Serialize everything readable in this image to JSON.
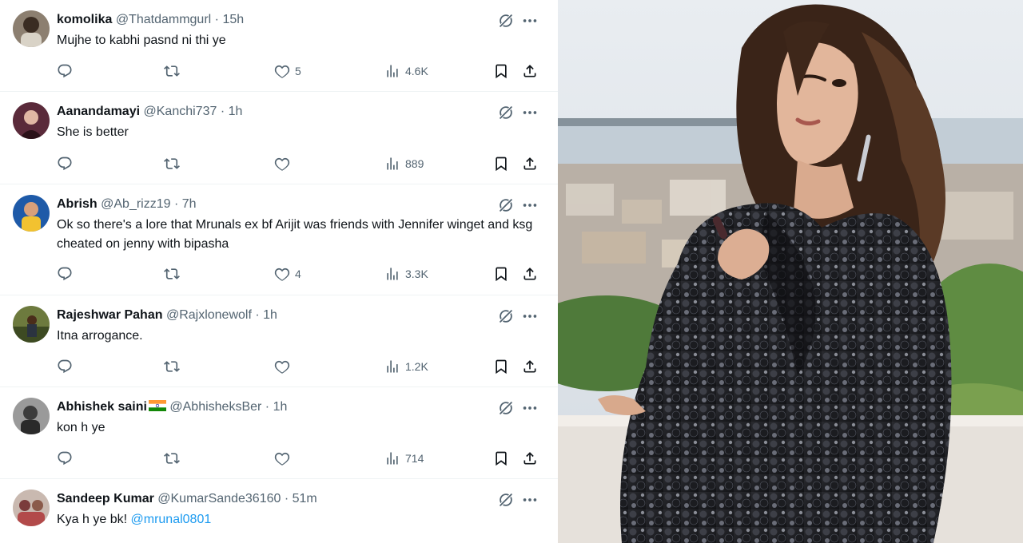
{
  "tweets": [
    {
      "name": "komolika",
      "handle": "@Thatdammgurl",
      "dot": "·",
      "time": "15h",
      "text": "Mujhe to kabhi pasnd ni thi ye",
      "likes": "5",
      "views": "4.6K"
    },
    {
      "name": "Aanandamayi",
      "handle": "@Kanchi737",
      "dot": "·",
      "time": "1h",
      "text": "She is better",
      "likes": "",
      "views": "889"
    },
    {
      "name": "Abrish",
      "handle": "@Ab_rizz19",
      "dot": "·",
      "time": "7h",
      "text": "Ok so there's a lore that Mrunals ex bf Arijit was friends with Jennifer winget and ksg cheated on jenny with bipasha",
      "likes": "4",
      "views": "3.3K"
    },
    {
      "name": "Rajeshwar Pahan",
      "handle": "@Rajxlonewolf",
      "dot": "·",
      "time": "1h",
      "text": "Itna arrogance.",
      "likes": "",
      "views": "1.2K"
    },
    {
      "name": "Abhishek saini",
      "handle": "@AbhisheksBer",
      "dot": "·",
      "time": "1h",
      "text": "kon h ye",
      "likes": "",
      "views": "714"
    },
    {
      "name": "Sandeep Kumar",
      "handle": "@KumarSande36160",
      "dot": "·",
      "time": "51m",
      "text": "Kya h ye bk!",
      "mention": "@mrunal0801",
      "likes": "",
      "views": ""
    }
  ],
  "icons": {
    "grok": "grok-icon",
    "more": "more-options-icon",
    "reply": "reply-icon",
    "retweet": "retweet-icon",
    "like": "heart-icon",
    "views": "views-chart-icon",
    "bookmark": "bookmark-icon",
    "share": "share-icon"
  },
  "colors": {
    "text": "#0f1419",
    "secondary": "#536471",
    "link": "#1d9bf0",
    "divider": "#eff3f4"
  }
}
